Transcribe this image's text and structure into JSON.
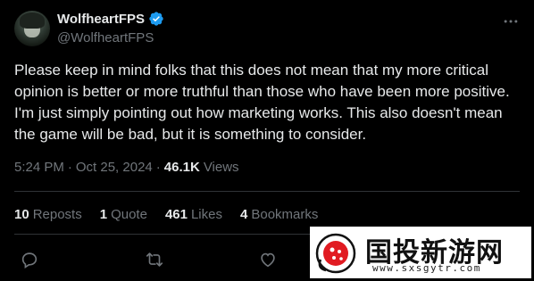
{
  "post": {
    "display_name": "WolfheartFPS",
    "handle": "@WolfheartFPS",
    "verified_color": "#1d9bf0",
    "text": "Please keep in mind folks that this does not mean that my more critical opinion is better or more truthful than those who have been more positive. I'm just simply pointing out how marketing works. This also doesn't mean the game will be bad, but it is something to consider.",
    "time": "5:24 PM",
    "date": "Oct 25, 2024",
    "views_count": "46.1K",
    "views_label": "Views"
  },
  "stats": {
    "reposts_count": "10",
    "reposts_label": "Reposts",
    "quotes_count": "1",
    "quotes_label": "Quote",
    "likes_count": "461",
    "likes_label": "Likes",
    "bookmarks_count": "4",
    "bookmarks_label": "Bookmarks"
  },
  "actions": {
    "icons": [
      "reply-icon",
      "repost-icon",
      "like-icon"
    ]
  },
  "watermark": {
    "title": "国投新游网",
    "url": "www.sxsgytr.com"
  },
  "colors": {
    "background": "#000000",
    "text": "#e7e9ea",
    "muted": "#71767b",
    "divider": "#2f3336"
  }
}
